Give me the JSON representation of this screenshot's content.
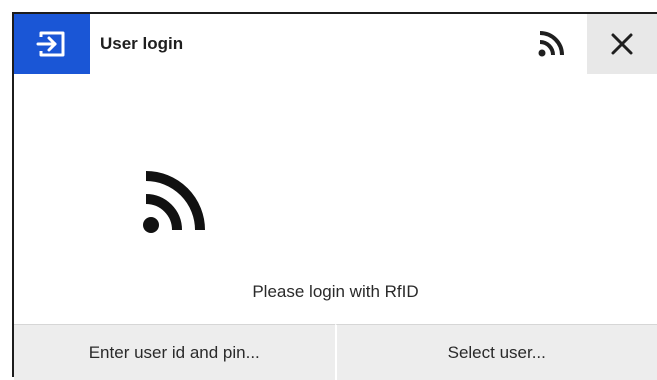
{
  "header": {
    "title": "User login",
    "login_icon": "login-icon",
    "rfid_icon": "rfid-icon",
    "close_icon": "close-icon",
    "accent_color": "#1a56d6"
  },
  "main": {
    "rfid_icon": "rfid-icon",
    "message": "Please login with RfID"
  },
  "footer": {
    "buttons": [
      {
        "label": "Enter user id and pin..."
      },
      {
        "label": "Select user..."
      }
    ]
  }
}
